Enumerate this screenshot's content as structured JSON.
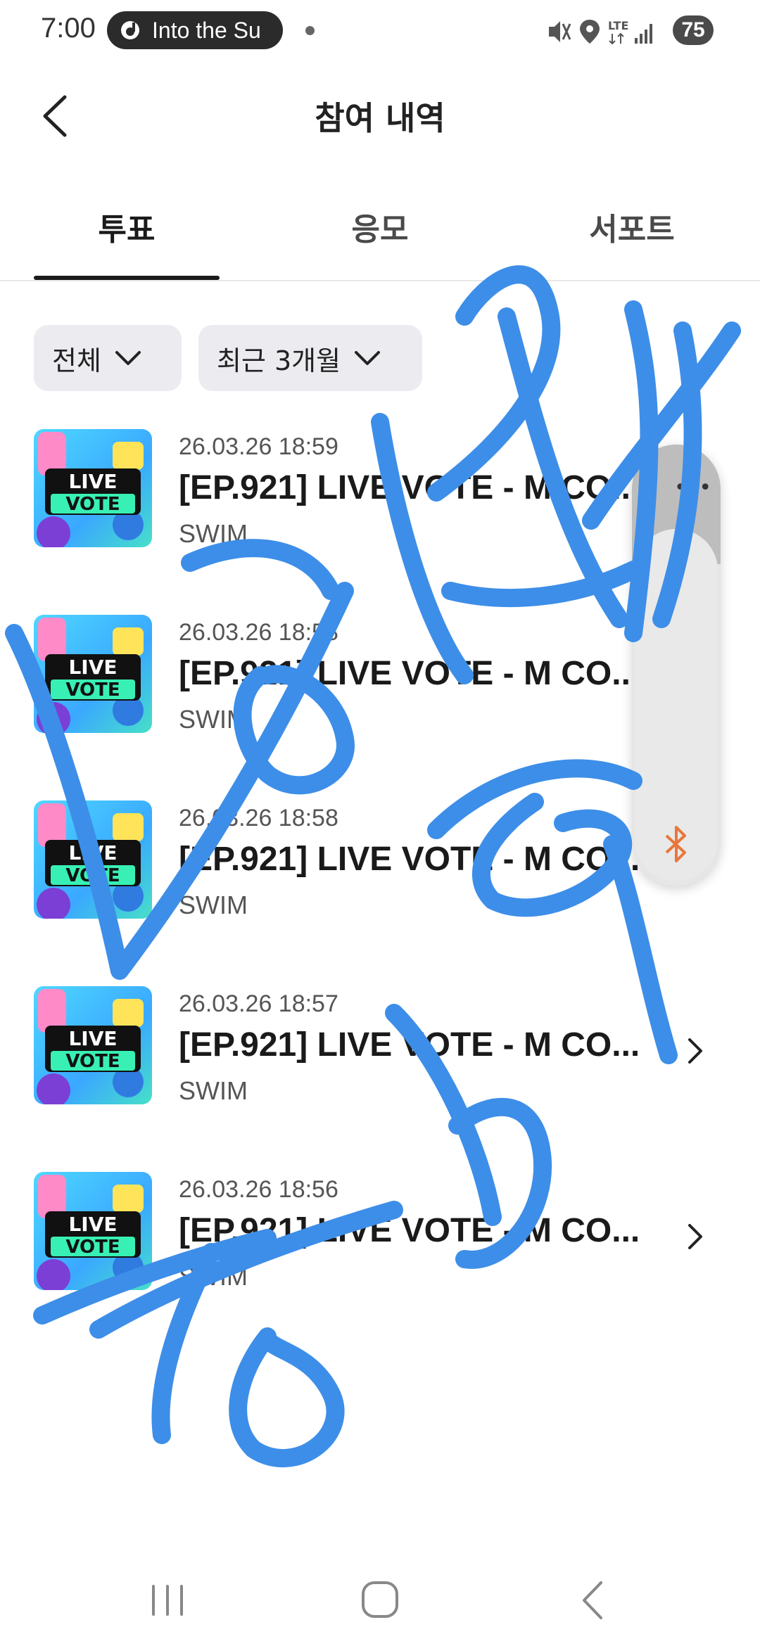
{
  "status_bar": {
    "time": "7:00",
    "media_pill_text": "Into the Su",
    "battery": "75",
    "icons": [
      "mute-icon",
      "location-icon",
      "lte-icon",
      "signal-icon"
    ]
  },
  "header": {
    "title": "참여 내역"
  },
  "tabs": [
    {
      "label": "투표",
      "active": true
    },
    {
      "label": "응모",
      "active": false
    },
    {
      "label": "서포트",
      "active": false
    }
  ],
  "filters": {
    "type_label": "전체",
    "period_label": "최근 3개월"
  },
  "list": [
    {
      "date": "26.03.26 18:59",
      "title": "[EP.921] LIVE VOTE - M CO...",
      "subtitle": "SWIM",
      "thumb_text_1": "LIVE",
      "thumb_text_2": "VOTE"
    },
    {
      "date": "26.03.26 18:58",
      "title": "[EP.921] LIVE VOTE - M CO...",
      "subtitle": "SWIM",
      "thumb_text_1": "LIVE",
      "thumb_text_2": "VOTE"
    },
    {
      "date": "26.03.26 18:58",
      "title": "[EP.921] LIVE VOTE - M CO...",
      "subtitle": "SWIM",
      "thumb_text_1": "LIVE",
      "thumb_text_2": "VOTE"
    },
    {
      "date": "26.03.26 18:57",
      "title": "[EP.921] LIVE VOTE - M CO...",
      "subtitle": "SWIM",
      "thumb_text_1": "LIVE",
      "thumb_text_2": "VOTE"
    },
    {
      "date": "26.03.26 18:56",
      "title": "[EP.921] LIVE VOTE - M CO...",
      "subtitle": "SWIM",
      "thumb_text_1": "LIVE",
      "thumb_text_2": "VOTE"
    }
  ],
  "colors": {
    "scribble": "#3d8ee8",
    "accent_bluetooth": "#e8773a",
    "chip_bg": "#ececf0"
  }
}
